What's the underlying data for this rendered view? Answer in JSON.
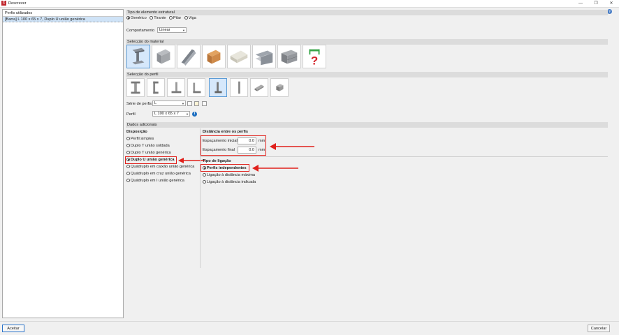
{
  "window": {
    "title": "Descrever",
    "minimize": "—",
    "restore": "❐",
    "close": "✕",
    "help": "?"
  },
  "left_panel": {
    "header": "Perfis utilizados",
    "items": [
      "[Barra] L 100 x 65 x 7, Duplo U união genérica"
    ]
  },
  "element_type": {
    "section": "Tipo de elemento estrutural",
    "options": [
      "Genérico",
      "Tirante",
      "Pilar",
      "Viga"
    ],
    "selected": "Genérico"
  },
  "behavior": {
    "label": "Comportamento",
    "value": "Linear"
  },
  "material": {
    "section": "Selecção do material",
    "tiles": [
      "steel-i-beam-icon",
      "concrete-block-icon",
      "cold-formed-steel-icon",
      "wood-timber-icon",
      "aluminium-icon",
      "composite-steel-icon",
      "masonry-icon",
      "generic-material-icon"
    ],
    "selected": 0
  },
  "profile": {
    "section": "Selecção do perfil",
    "tiles": [
      "i-profile-icon",
      "c-profile-icon",
      "t-profile-icon",
      "angle-profile-icon",
      "angle-l-profile-icon",
      "flat-bar-icon",
      "round-bar-icon",
      "square-bar-icon"
    ],
    "selected": 4,
    "series_label": "Série de perfis",
    "series_value": "L",
    "profile_label": "Perfil",
    "profile_value": "L 100 x 65 x 7"
  },
  "additional": {
    "section": "Dados adicionais",
    "layout_title": "Disposição",
    "layout_options": [
      "Perfil simples",
      "Duplo T união soldada",
      "Duplo T união genérica",
      "Duplo U união genérica",
      "Quádruplo em caixão união genérica",
      "Quádruplo em cruz união genérica",
      "Quádruplo em I união genérica"
    ],
    "layout_selected": "Duplo U união genérica",
    "distance_title": "Distância entre os perfis",
    "initial_spacing_label": "Espaçamento inicial",
    "initial_spacing_value": "0.0",
    "final_spacing_label": "Espaçamento final",
    "final_spacing_value": "0.0",
    "unit": "mm",
    "connection_title": "Tipo de ligação",
    "connection_options": [
      "Perfis independentes",
      "Ligação à distância máxima",
      "Ligação à distância indicada"
    ],
    "connection_selected": "Perfis independentes"
  },
  "footer": {
    "accept": "Aceitar",
    "cancel": "Cancelar"
  },
  "colors": {
    "accent": "#2a72c9",
    "highlight": "#e0201b",
    "selected_tile": "#d6e8fb"
  }
}
